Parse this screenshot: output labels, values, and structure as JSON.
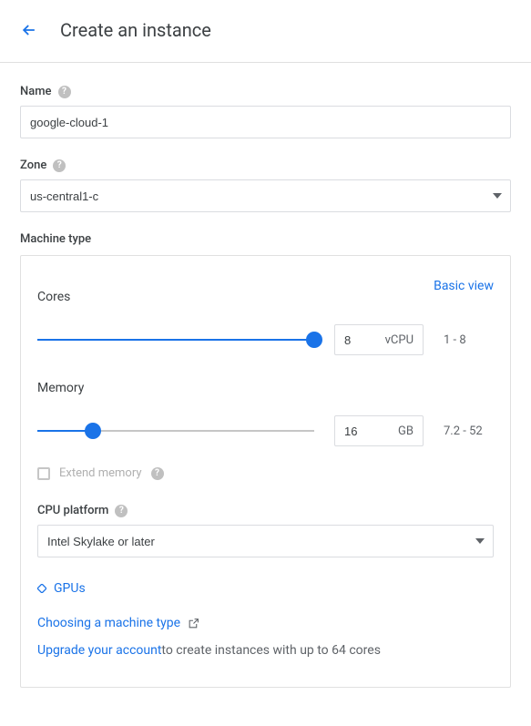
{
  "header": {
    "title": "Create an instance"
  },
  "name_field": {
    "label": "Name",
    "value": "google-cloud-1"
  },
  "zone_field": {
    "label": "Zone",
    "value": "us-central1-c"
  },
  "machine": {
    "label": "Machine type",
    "basic_view": "Basic view",
    "cores": {
      "label": "Cores",
      "value": "8",
      "unit": "vCPU",
      "range": "1 - 8",
      "fill_pct": 100
    },
    "memory": {
      "label": "Memory",
      "value": "16",
      "unit": "GB",
      "range": "7.2 - 52",
      "fill_pct": 20
    },
    "extend_memory": "Extend memory",
    "cpu_platform": {
      "label": "CPU platform",
      "value": "Intel Skylake or later"
    },
    "gpus_label": "GPUs",
    "choosing_link": "Choosing a machine type",
    "upgrade_link": "Upgrade your account",
    "upgrade_rest": " to create instances with up to 64 cores"
  }
}
